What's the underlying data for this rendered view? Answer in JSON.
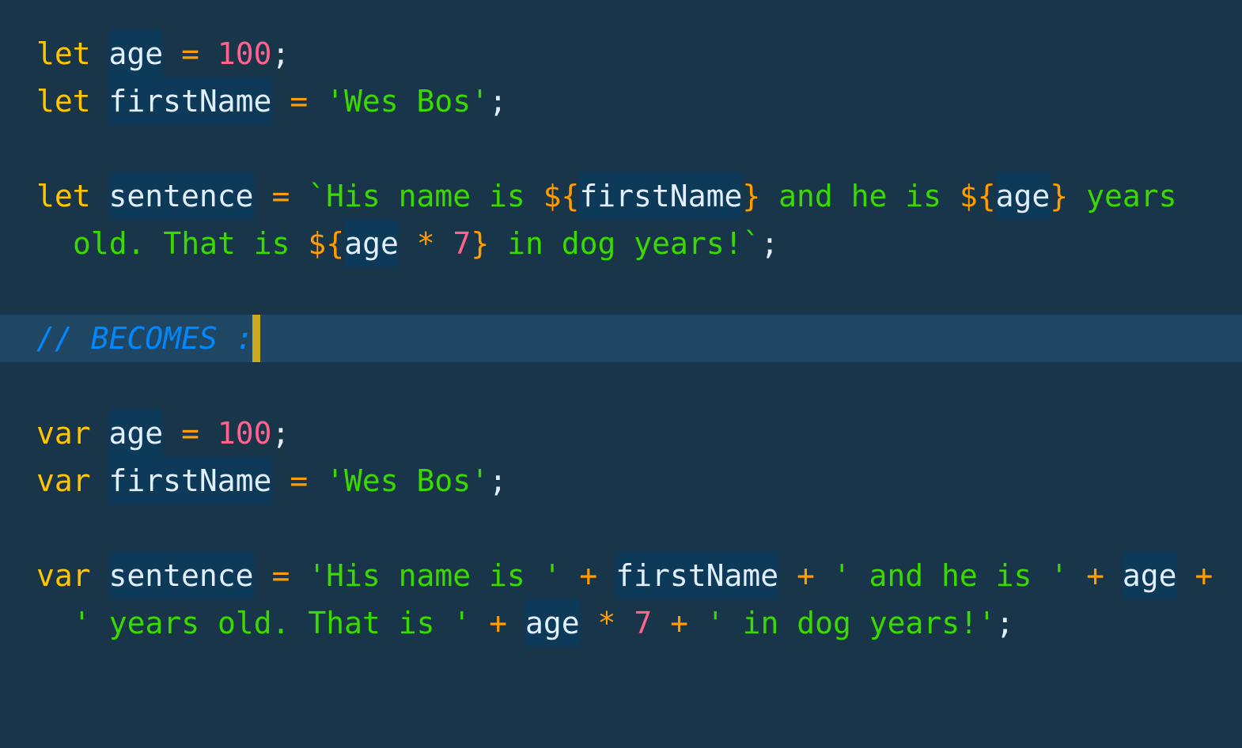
{
  "code": {
    "l1": {
      "kw": "let",
      "var": "age",
      "op": "=",
      "num": "100",
      "end": ";"
    },
    "l2": {
      "kw": "let",
      "var": "firstName",
      "op": "=",
      "str": "'Wes Bos'",
      "end": ";"
    },
    "l3": {
      "kw": "let",
      "var": "sentence",
      "op": "=",
      "s1": "`His name is ",
      "i1o": "${",
      "i1v": "firstName",
      "i1c": "}",
      "s2": " and he is ",
      "i2o": "${",
      "i2v": "age",
      "i2c": "}",
      "s3": " years"
    },
    "l4": {
      "s1": "old. That is ",
      "i1o": "${",
      "i1v": "age",
      "mul": "*",
      "num": "7",
      "i1c": "}",
      "s2": " in dog years!`",
      "end": ";"
    },
    "l5": {
      "comment": "// BECOMES :"
    },
    "l6": {
      "kw": "var",
      "var": "age",
      "op": "=",
      "num": "100",
      "end": ";"
    },
    "l7": {
      "kw": "var",
      "var": "firstName",
      "op": "=",
      "str": "'Wes Bos'",
      "end": ";"
    },
    "l8": {
      "kw": "var",
      "var": "sentence",
      "op": "=",
      "s1": "'His name is '",
      "p1": "+",
      "v1": "firstName",
      "p2": "+",
      "s2": "' and he is '",
      "p3": "+",
      "v2": "age",
      "p4": "+"
    },
    "l9": {
      "s1": "' years old. That is '",
      "p1": "+",
      "v1": "age",
      "mul": "*",
      "num": "7",
      "p2": "+",
      "s2": "' in dog years!'",
      "end": ";"
    }
  },
  "theme": {
    "background": "#193549",
    "active_line": "#1f4662",
    "keyword": "#ffc600",
    "operator": "#ff9d00",
    "number": "#ff628c",
    "string": "#3ad900",
    "comment": "#0088ff",
    "identifier_highlight": "#0d3a58",
    "cursor": "#c9aa1d"
  }
}
